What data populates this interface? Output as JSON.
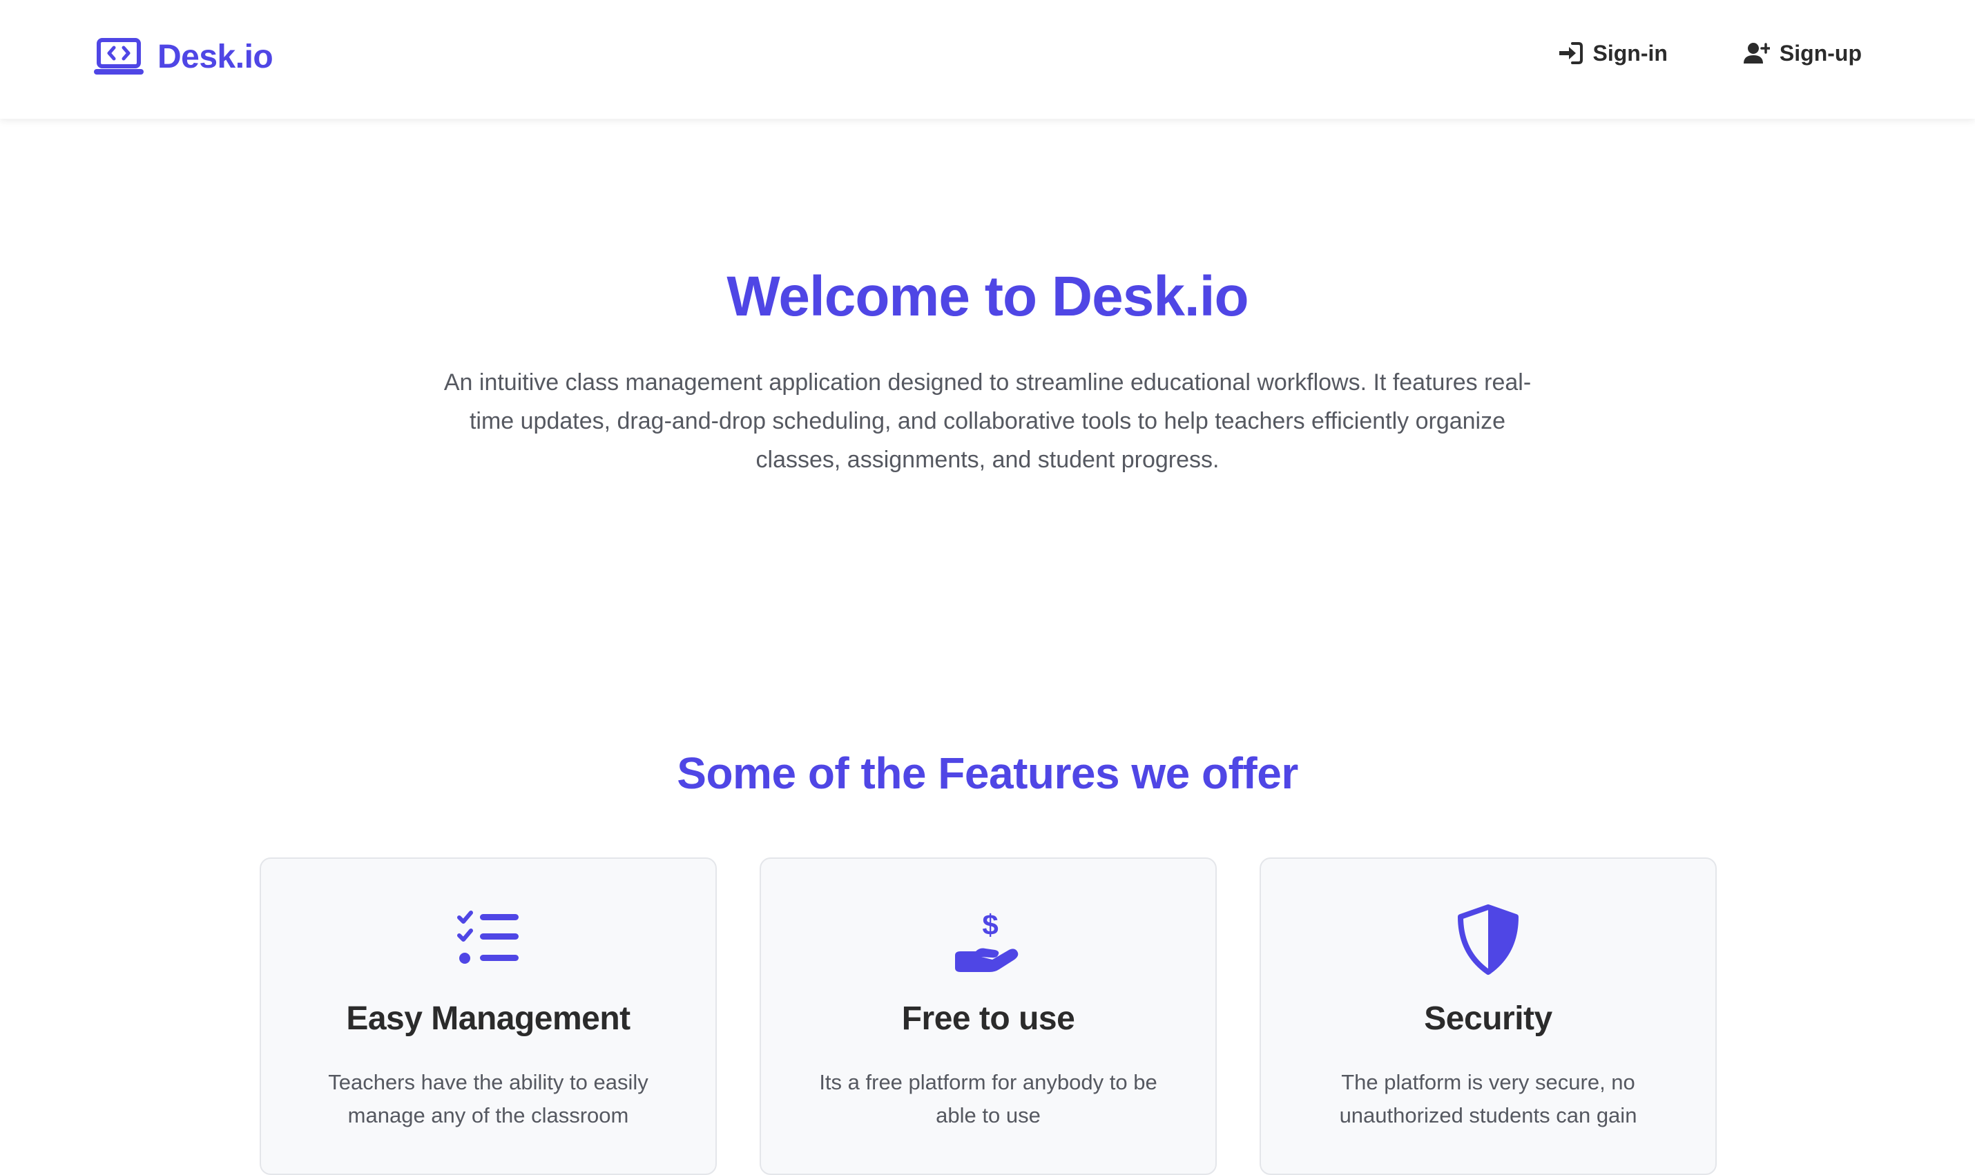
{
  "brand": {
    "name": "Desk.io",
    "accent_color": "#4f46e5",
    "icon": "laptop-code-icon"
  },
  "nav": {
    "signin_label": "Sign-in",
    "signin_icon": "sign-in-icon",
    "signup_label": "Sign-up",
    "signup_icon": "user-plus-icon"
  },
  "hero": {
    "title": "Welcome to Desk.io",
    "description": "An intuitive class management application designed to streamline educational workflows. It features real-time updates, drag-and-drop scheduling, and collaborative tools to help teachers efficiently organize classes, assignments, and student progress."
  },
  "features": {
    "title": "Some of the Features we offer",
    "cards": [
      {
        "icon": "checklist-icon",
        "title": "Easy Management",
        "description": "Teachers have the ability to easily manage any of the classroom"
      },
      {
        "icon": "hand-dollar-icon",
        "title": "Free to use",
        "description": "Its a free platform for anybody to be able to use"
      },
      {
        "icon": "shield-icon",
        "title": "Security",
        "description": "The platform is very secure, no unauthorized students can gain"
      }
    ]
  }
}
